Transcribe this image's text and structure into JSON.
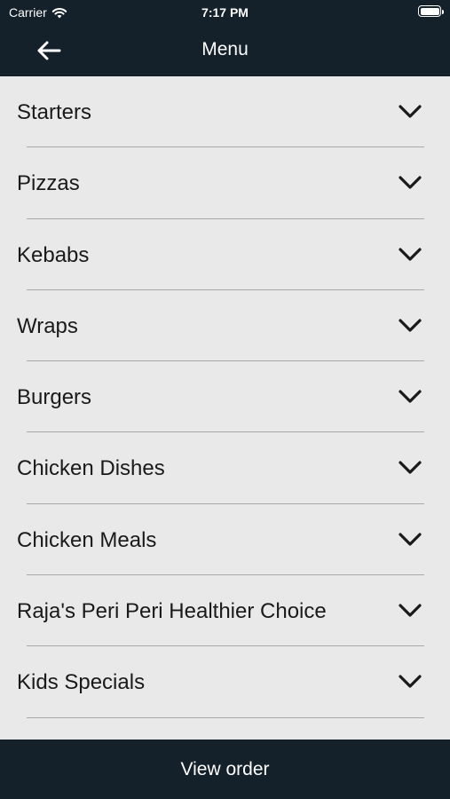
{
  "status_bar": {
    "carrier": "Carrier",
    "time": "7:17 PM"
  },
  "header": {
    "title": "Menu"
  },
  "menu": {
    "items": [
      {
        "label": "Starters"
      },
      {
        "label": "Pizzas"
      },
      {
        "label": "Kebabs"
      },
      {
        "label": "Wraps"
      },
      {
        "label": "Burgers"
      },
      {
        "label": "Chicken Dishes"
      },
      {
        "label": "Chicken Meals"
      },
      {
        "label": "Raja's Peri Peri Healthier Choice"
      },
      {
        "label": "Kids Specials"
      }
    ]
  },
  "footer": {
    "view_order_label": "View order"
  },
  "colors": {
    "bar_background": "#14202a",
    "list_background": "#e9e9e9",
    "divider": "#a9a9a9"
  }
}
